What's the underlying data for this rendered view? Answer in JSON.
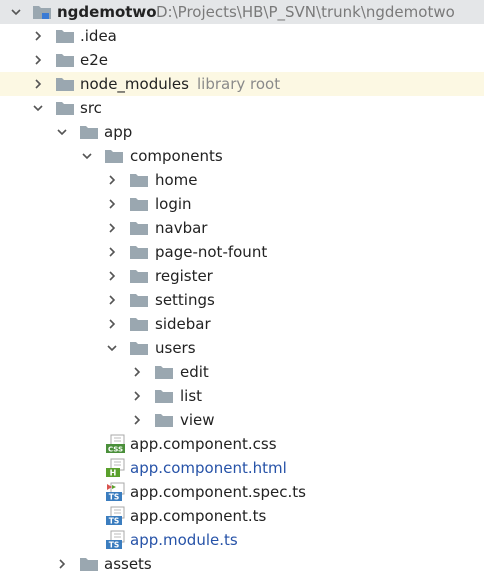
{
  "tree": {
    "root": {
      "label": "ngdemotwo",
      "path": "D:\\Projects\\HB\\P_SVN\\trunk\\ngdemotwo"
    },
    "items": [
      {
        "label": ".idea"
      },
      {
        "label": "e2e"
      },
      {
        "label": "node_modules",
        "hint": "library root"
      },
      {
        "label": "src"
      },
      {
        "label": "app"
      },
      {
        "label": "components"
      },
      {
        "label": "home"
      },
      {
        "label": "login"
      },
      {
        "label": "navbar"
      },
      {
        "label": "page-not-fount"
      },
      {
        "label": "register"
      },
      {
        "label": "settings"
      },
      {
        "label": "sidebar"
      },
      {
        "label": "users"
      },
      {
        "label": "edit"
      },
      {
        "label": "list"
      },
      {
        "label": "view"
      },
      {
        "label": "app.component.css",
        "icon": "CSS"
      },
      {
        "label": "app.component.html",
        "icon": "H"
      },
      {
        "label": "app.component.spec.ts",
        "icon": "TS"
      },
      {
        "label": "app.component.ts",
        "icon": "TS"
      },
      {
        "label": "app.module.ts",
        "icon": "TS"
      },
      {
        "label": "assets"
      }
    ]
  },
  "colors": {
    "folder": "#9aa7b0",
    "vcs_modified": "#2753a8",
    "library_row": "#fcf8e3",
    "css_icon": "#4a8f3a",
    "html_icon": "#5aa02c",
    "ts_icon": "#3b7dbf"
  }
}
